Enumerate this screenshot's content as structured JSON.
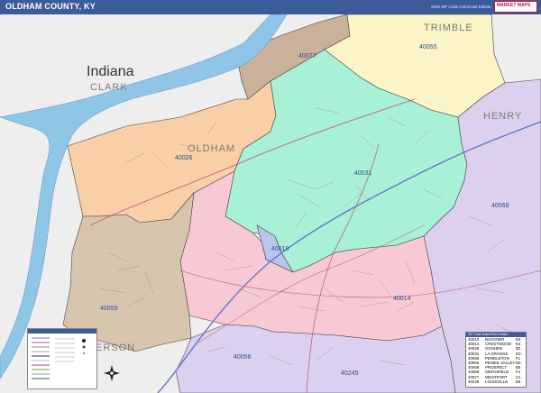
{
  "header": {
    "title": "OLDHAM COUNTY, KY",
    "subtitle": "2020 ZIP Code ColorCast Edition"
  },
  "logo": {
    "text": "MARKET MAPS"
  },
  "map_labels": {
    "state": "Indiana",
    "counties": [
      "CLARK",
      "OLDHAM",
      "TRIMBLE",
      "HENRY",
      "ERSON"
    ]
  },
  "zip_areas": [
    {
      "zip": "40077",
      "color": "#c9b19a"
    },
    {
      "zip": "40055",
      "color": "#faf4c6"
    },
    {
      "zip": "40026",
      "color": "#f8cfa6"
    },
    {
      "zip": "40031",
      "color": "#a8f0d6"
    },
    {
      "zip": "40068",
      "color": "#ddd0ee"
    },
    {
      "zip": "40010",
      "color": "#b9c6ec"
    },
    {
      "zip": "40014",
      "color": "#f6c9d4"
    },
    {
      "zip": "40059",
      "color": "#d8c5ae"
    },
    {
      "zip": "40056",
      "color": "#a8ecc4"
    },
    {
      "zip": "40245",
      "color": "#dcd0f0"
    }
  ],
  "zip_index": {
    "header": "ZIP Code Index/Grid Locator",
    "rows": [
      {
        "zip": "40010",
        "name": "BUCKNER",
        "grid": "D4"
      },
      {
        "zip": "40014",
        "name": "CRESTWOOD",
        "grid": "E4"
      },
      {
        "zip": "40026",
        "name": "GOSHEN",
        "grid": "B2"
      },
      {
        "zip": "40031",
        "name": "LA GRANGE",
        "grid": "D3"
      },
      {
        "zip": "40055",
        "name": "PENDLETON",
        "grid": "F1"
      },
      {
        "zip": "40056",
        "name": "PEWEE VALLEY",
        "grid": "D5"
      },
      {
        "zip": "40059",
        "name": "PROSPECT",
        "grid": "B5"
      },
      {
        "zip": "40068",
        "name": "SMITHFIELD",
        "grid": "F4"
      },
      {
        "zip": "40077",
        "name": "WESTPORT",
        "grid": "C1"
      },
      {
        "zip": "40245",
        "name": "LOUISVILLE",
        "grid": "E5"
      }
    ]
  },
  "colors": {
    "river": "#8fc6e8",
    "header": "#3b5b9a",
    "zip_text": "#2a4d8f"
  }
}
